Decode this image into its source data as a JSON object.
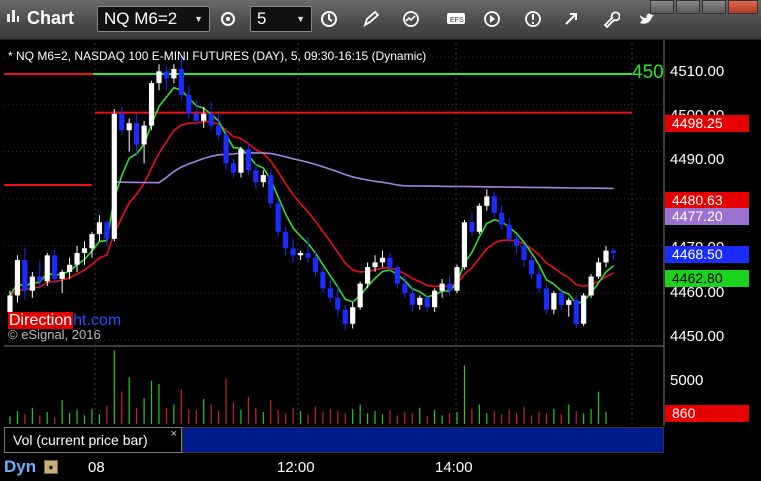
{
  "window": {
    "title": "Chart",
    "symbol_combo": "NQ M6=2",
    "interval_combo": "5"
  },
  "chart": {
    "symbol_line": "* NQ M6=2, NASDAQ 100 E-MINI FUTURES (DAY), 5, 09:30-16:15 (Dynamic)",
    "corner_label": "450",
    "watermark_part1": "Direction",
    "watermark_part2": "ht.com",
    "copyright": "© eSignal, 2016",
    "y_ticks": [
      "4510.00",
      "4500.00",
      "4490.00",
      "4470.00",
      "4460.00",
      "4450.00"
    ],
    "price_boxes": [
      {
        "value": "4498.25",
        "bg": "#e60000",
        "fg": "#ffffff"
      },
      {
        "value": "4480.63",
        "bg": "#e60000",
        "fg": "#ffffff"
      },
      {
        "value": "4477.20",
        "bg": "#9b72d0",
        "fg": "#ffffff"
      },
      {
        "value": "4468.50",
        "bg": "#1a2cff",
        "fg": "#ffffff"
      },
      {
        "value": "4462.80",
        "bg": "#19d31c",
        "fg": "#000000"
      }
    ],
    "volume_tick": "5000",
    "volume_box": {
      "value": "860",
      "bg": "#e60000",
      "fg": "#ffffff"
    },
    "volume_study": "Vol (current price bar)",
    "x_ticks": [
      "08",
      "12:00",
      "14:00"
    ],
    "bottom_label": "Dyn",
    "colors": {
      "up": "#ffffff",
      "down": "#1a2cff",
      "ma_fast": "#33dd33",
      "ma_mid": "#ee1111",
      "ma_slow": "#a585e0",
      "level": "#ee1111"
    }
  },
  "chart_data": {
    "type": "candlestick",
    "title": "",
    "ylim": [
      4449,
      4513
    ],
    "grid": true,
    "candles": [
      [
        4456.0,
        4460.5,
        4454.5,
        4459.5
      ],
      [
        4459.5,
        4468.0,
        4458.0,
        4467.0
      ],
      [
        4467.0,
        4469.5,
        4458.5,
        4460.5
      ],
      [
        4460.5,
        4464.5,
        4459.0,
        4463.5
      ],
      [
        4463.5,
        4467.0,
        4461.0,
        4462.5
      ],
      [
        4462.5,
        4468.5,
        4461.5,
        4468.0
      ],
      [
        4468.0,
        4469.0,
        4462.0,
        4463.0
      ],
      [
        4463.0,
        4465.0,
        4460.0,
        4464.5
      ],
      [
        4464.5,
        4467.5,
        4463.0,
        4466.0
      ],
      [
        4466.0,
        4470.0,
        4464.5,
        4468.5
      ],
      [
        4468.5,
        4471.0,
        4466.0,
        4469.5
      ],
      [
        4469.5,
        4473.0,
        4467.5,
        4472.5
      ],
      [
        4472.5,
        4476.5,
        4471.0,
        4475.0
      ],
      [
        4475.0,
        4475.5,
        4470.0,
        4471.5
      ],
      [
        4471.5,
        4499.0,
        4471.0,
        4498.0
      ],
      [
        4498.0,
        4499.5,
        4493.5,
        4494.5
      ],
      [
        4494.5,
        4497.0,
        4490.0,
        4496.0
      ],
      [
        4496.0,
        4498.0,
        4489.0,
        4491.5
      ],
      [
        4491.5,
        4496.5,
        4487.5,
        4495.5
      ],
      [
        4495.5,
        4505.0,
        4494.5,
        4504.5
      ],
      [
        4504.5,
        4508.5,
        4503.0,
        4507.0
      ],
      [
        4507.0,
        4508.0,
        4503.0,
        4505.5
      ],
      [
        4505.5,
        4508.5,
        4504.5,
        4507.5
      ],
      [
        4507.5,
        4510.0,
        4501.0,
        4502.0
      ],
      [
        4502.0,
        4504.0,
        4497.0,
        4498.0
      ],
      [
        4498.0,
        4501.0,
        4495.5,
        4496.5
      ],
      [
        4496.5,
        4499.5,
        4495.0,
        4498.0
      ],
      [
        4498.0,
        4500.5,
        4494.5,
        4495.5
      ],
      [
        4495.5,
        4498.0,
        4492.5,
        4493.5
      ],
      [
        4493.5,
        4495.0,
        4486.0,
        4487.5
      ],
      [
        4487.5,
        4488.5,
        4484.5,
        4485.5
      ],
      [
        4485.5,
        4491.0,
        4484.5,
        4490.5
      ],
      [
        4490.5,
        4492.0,
        4485.0,
        4486.0
      ],
      [
        4486.0,
        4487.5,
        4482.0,
        4483.5
      ],
      [
        4483.5,
        4486.0,
        4482.5,
        4485.0
      ],
      [
        4485.0,
        4486.0,
        4478.0,
        4479.0
      ],
      [
        4479.0,
        4480.0,
        4472.0,
        4473.0
      ],
      [
        4473.0,
        4474.0,
        4468.0,
        4469.5
      ],
      [
        4469.5,
        4471.5,
        4466.5,
        4468.0
      ],
      [
        4468.0,
        4469.0,
        4467.0,
        4468.5
      ],
      [
        4468.5,
        4472.0,
        4466.5,
        4467.5
      ],
      [
        4467.5,
        4469.0,
        4463.5,
        4464.5
      ],
      [
        4464.5,
        4465.5,
        4460.0,
        4461.0
      ],
      [
        4461.0,
        4463.0,
        4458.0,
        4459.0
      ],
      [
        4459.0,
        4461.5,
        4455.0,
        4456.5
      ],
      [
        4456.5,
        4457.5,
        4452.0,
        4453.5
      ],
      [
        4453.5,
        4458.0,
        4452.5,
        4457.0
      ],
      [
        4457.0,
        4462.5,
        4456.5,
        4462.0
      ],
      [
        4462.0,
        4466.5,
        4461.0,
        4465.5
      ],
      [
        4465.5,
        4468.0,
        4464.5,
        4466.5
      ],
      [
        4466.5,
        4469.0,
        4465.5,
        4467.5
      ],
      [
        4467.5,
        4468.5,
        4464.5,
        4465.5
      ],
      [
        4465.5,
        4466.0,
        4461.0,
        4462.0
      ],
      [
        4462.0,
        4464.0,
        4459.0,
        4460.0
      ],
      [
        4460.0,
        4461.0,
        4456.0,
        4457.5
      ],
      [
        4457.5,
        4459.5,
        4456.5,
        4459.0
      ],
      [
        4459.0,
        4459.5,
        4456.0,
        4457.0
      ],
      [
        4457.0,
        4461.0,
        4456.0,
        4460.5
      ],
      [
        4460.5,
        4463.0,
        4459.0,
        4462.0
      ],
      [
        4462.0,
        4463.5,
        4459.5,
        4460.5
      ],
      [
        4460.5,
        4466.0,
        4460.0,
        4465.5
      ],
      [
        4465.5,
        4475.5,
        4465.0,
        4475.0
      ],
      [
        4475.0,
        4477.0,
        4472.0,
        4473.0
      ],
      [
        4473.0,
        4479.0,
        4472.5,
        4478.5
      ],
      [
        4478.5,
        4482.0,
        4477.5,
        4480.5
      ],
      [
        4480.5,
        4481.5,
        4476.0,
        4477.0
      ],
      [
        4477.0,
        4478.5,
        4473.5,
        4474.5
      ],
      [
        4474.5,
        4476.0,
        4470.5,
        4471.5
      ],
      [
        4471.5,
        4472.5,
        4468.5,
        4470.0
      ],
      [
        4470.0,
        4470.5,
        4465.5,
        4467.0
      ],
      [
        4467.0,
        4468.0,
        4463.0,
        4464.0
      ],
      [
        4464.0,
        4465.5,
        4460.0,
        4461.0
      ],
      [
        4461.0,
        4462.0,
        4455.5,
        4456.5
      ],
      [
        4456.5,
        4460.5,
        4455.5,
        4460.0
      ],
      [
        4460.0,
        4461.0,
        4456.5,
        4457.5
      ],
      [
        4457.5,
        4459.0,
        4455.0,
        4458.5
      ],
      [
        4458.5,
        4459.5,
        4452.5,
        4453.5
      ],
      [
        4453.5,
        4460.0,
        4453.0,
        4459.5
      ],
      [
        4459.5,
        4464.0,
        4459.0,
        4463.5
      ],
      [
        4463.5,
        4467.5,
        4463.0,
        4466.5
      ],
      [
        4466.5,
        4470.0,
        4465.5,
        4469.0
      ],
      [
        4469.0,
        4469.5,
        4467.0,
        4468.5
      ]
    ],
    "volume": [
      700,
      1200,
      900,
      1500,
      800,
      1100,
      600,
      2200,
      1000,
      1300,
      800,
      1400,
      900,
      1700,
      6800,
      3000,
      4300,
      1500,
      2400,
      4000,
      3700,
      1500,
      1800,
      3200,
      1400,
      1300,
      2300,
      1800,
      1200,
      4200,
      2000,
      1300,
      2500,
      1500,
      1100,
      2200,
      1300,
      1000,
      1500,
      1200,
      900,
      1600,
      1100,
      1400,
      1200,
      1000,
      1400,
      1800,
      1000,
      1200,
      900,
      1300,
      800,
      1100,
      1000,
      1500,
      700,
      1300,
      800,
      1000,
      1100,
      5400,
      1400,
      1800,
      1000,
      1200,
      900,
      1300,
      1000,
      1600,
      800,
      1100,
      1000,
      1400,
      900,
      1800,
      1200,
      1000,
      1400,
      3000,
      1100
    ]
  }
}
